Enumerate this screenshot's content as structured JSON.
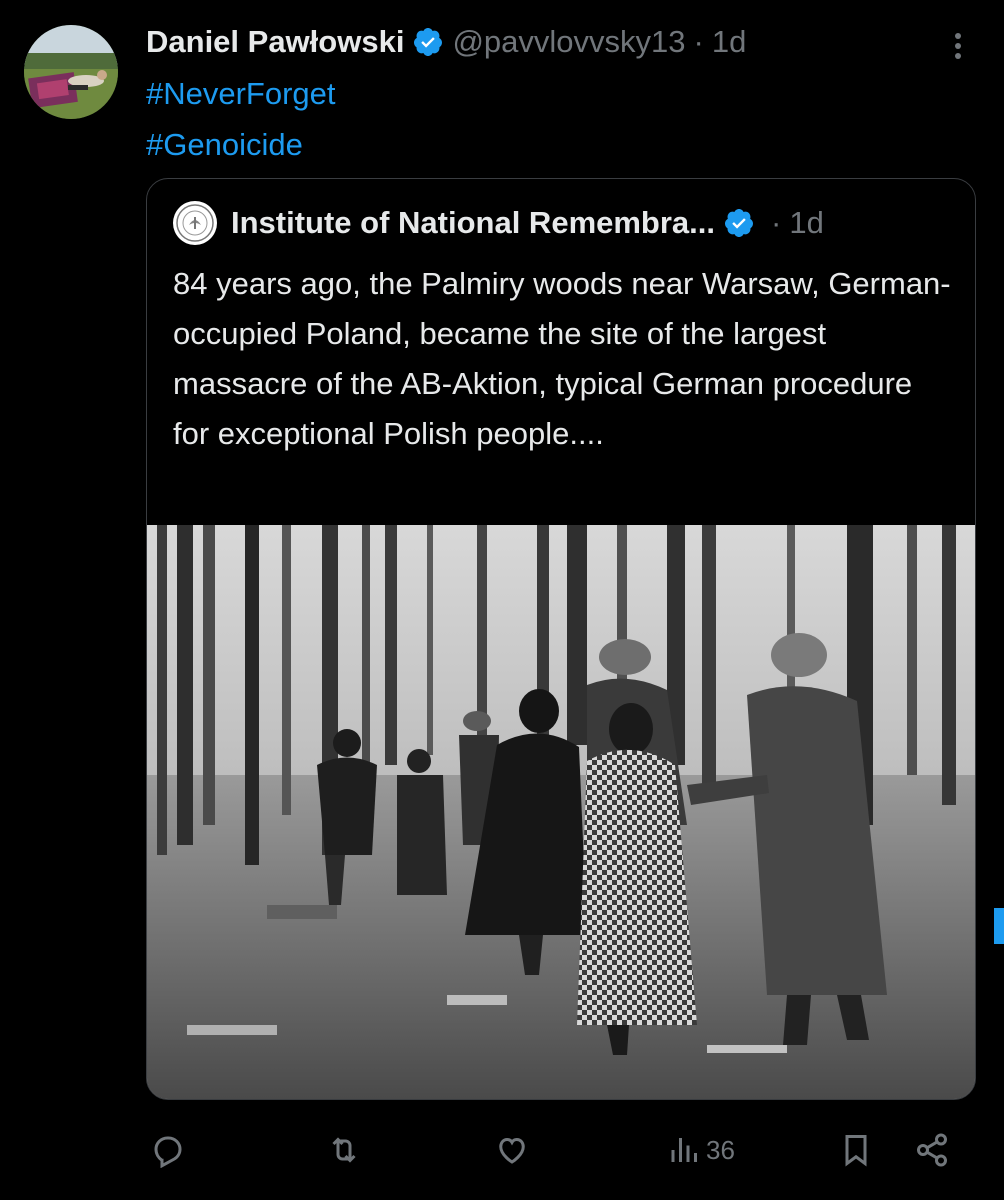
{
  "tweet": {
    "author_name": "Daniel Pawłowski",
    "handle": "@pavvlovvsky13",
    "separator": "·",
    "time": "1d",
    "hashtags": [
      "#NeverForget",
      "#Genoicide"
    ]
  },
  "quoted": {
    "author_name": "Institute of National Remembra...",
    "separator": "·",
    "time": "1d",
    "text": "84 years ago, the Palmiry woods near Warsaw, German-occupied Poland, became the site of the largest massacre of the AB-Aktion, typical German procedure for exceptional Polish people....",
    "media_icon": "historical-photo"
  },
  "actions": {
    "views": "36",
    "icons": [
      "reply-icon",
      "retweet-icon",
      "like-icon",
      "views-icon",
      "bookmark-icon",
      "share-icon"
    ]
  },
  "colors": {
    "background": "#000000",
    "text": "#e7e9ea",
    "muted": "#71767b",
    "accent": "#1d9bf0",
    "border": "#3a3d41"
  }
}
